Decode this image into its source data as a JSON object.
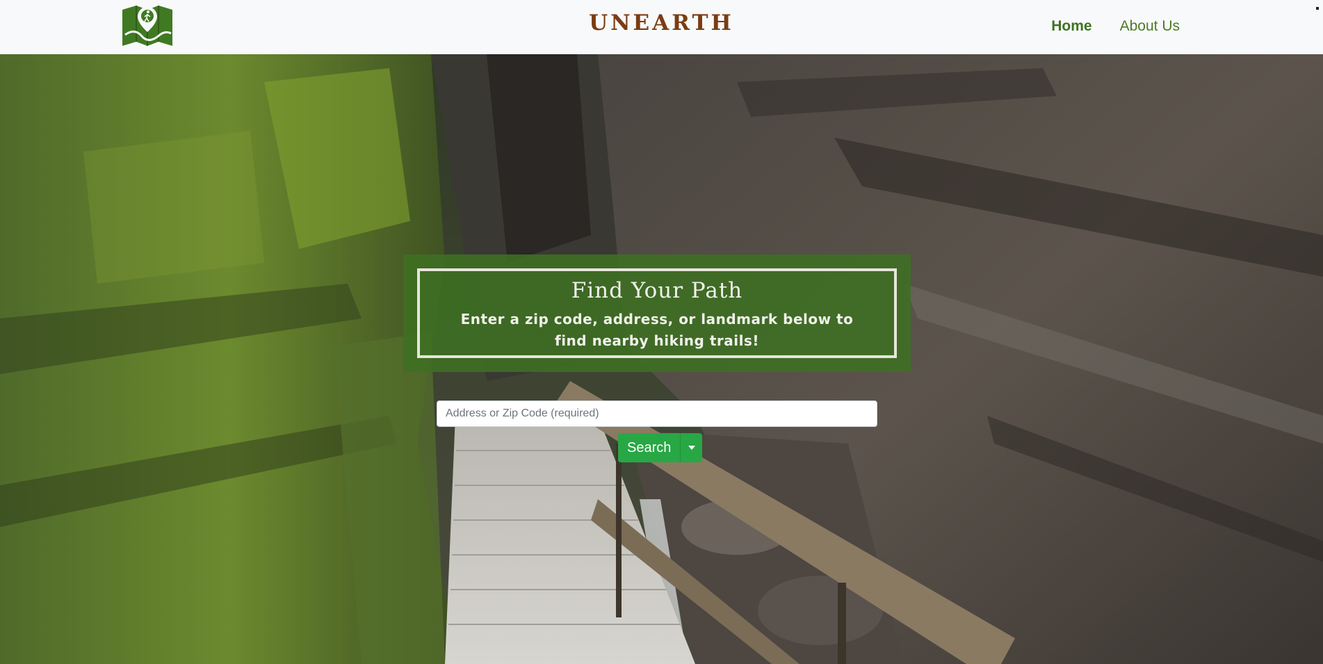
{
  "navbar": {
    "brand": "UNEARTH",
    "logo_icon": "map-hiker-logo-icon",
    "links": [
      {
        "label": "Home",
        "active": true
      },
      {
        "label": "About Us",
        "active": false
      }
    ]
  },
  "hero": {
    "background": "photo of a wooden boardwalk through a mossy rock gorge",
    "title": "Find Your Path",
    "subtitle": "Enter a zip code, address, or landmark below to find nearby hiking trails!"
  },
  "search": {
    "placeholder": "Address or Zip Code (required)",
    "value": "",
    "button_label": "Search",
    "dropdown_icon": "caret-down-icon"
  },
  "colors": {
    "navbar_bg": "#f8f9fa",
    "brand": "#7a3c12",
    "nav_link": "#4d7a26",
    "panel_bg": "#3e7022",
    "panel_border": "#e8e5dc",
    "search_button": "#28a745"
  }
}
